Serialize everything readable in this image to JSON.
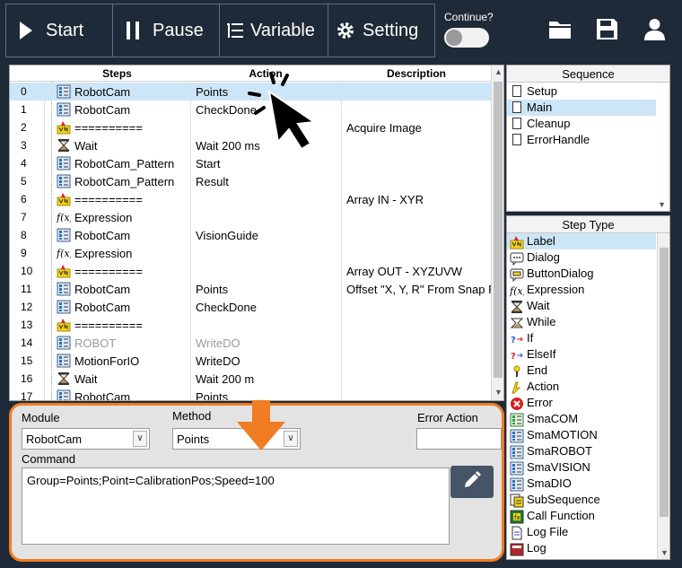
{
  "toolbar": {
    "start_label": "Start",
    "pause_label": "Pause",
    "variable_label": "Variable",
    "setting_label": "Setting",
    "continue_label": "Continue?"
  },
  "steps_table": {
    "columns": [
      "Steps",
      "Action",
      "Description"
    ],
    "rows": [
      {
        "num": "0",
        "step": "RobotCam",
        "action": "Points",
        "desc": "",
        "icon": "module-icon"
      },
      {
        "num": "1",
        "step": "RobotCam",
        "action": "CheckDone",
        "desc": "",
        "icon": "module-icon"
      },
      {
        "num": "2",
        "step": "==========",
        "action": "",
        "desc": "Acquire Image",
        "icon": "label-icon"
      },
      {
        "num": "3",
        "step": "Wait",
        "action": "Wait 200 ms",
        "desc": "",
        "icon": "hourglass-icon"
      },
      {
        "num": "4",
        "step": "RobotCam_Pattern",
        "action": "Start",
        "desc": "",
        "icon": "module-icon"
      },
      {
        "num": "5",
        "step": "RobotCam_Pattern",
        "action": "Result",
        "desc": "",
        "icon": "module-icon"
      },
      {
        "num": "6",
        "step": "==========",
        "action": "",
        "desc": "Array IN - XYR",
        "icon": "label-icon"
      },
      {
        "num": "7",
        "step": "Expression",
        "action": "",
        "desc": "",
        "icon": "expression-icon"
      },
      {
        "num": "8",
        "step": "RobotCam",
        "action": "VisionGuide",
        "desc": "",
        "icon": "module-icon"
      },
      {
        "num": "9",
        "step": "Expression",
        "action": "",
        "desc": "",
        "icon": "expression-icon"
      },
      {
        "num": "10",
        "step": "==========",
        "action": "",
        "desc": "Array OUT - XYZUVW",
        "icon": "label-icon"
      },
      {
        "num": "11",
        "step": "RobotCam",
        "action": "Points",
        "desc": "Offset \"X, Y, R\" From Snap P",
        "icon": "module-icon"
      },
      {
        "num": "12",
        "step": "RobotCam",
        "action": "CheckDone",
        "desc": "",
        "icon": "module-icon"
      },
      {
        "num": "13",
        "step": "==========",
        "action": "",
        "desc": "",
        "icon": "label-icon"
      },
      {
        "num": "14",
        "step": "ROBOT",
        "action": "WriteDO",
        "desc": "",
        "icon": "module-icon"
      },
      {
        "num": "15",
        "step": "MotionForIO",
        "action": "WriteDO",
        "desc": "",
        "icon": "module-icon"
      },
      {
        "num": "16",
        "step": "Wait",
        "action": "Wait 200 m",
        "desc": "",
        "icon": "hourglass-icon"
      },
      {
        "num": "17",
        "step": "RobotCam",
        "action": "Points",
        "desc": "",
        "icon": "module-icon"
      }
    ]
  },
  "sequence": {
    "title": "Sequence",
    "items": [
      "Setup",
      "Main",
      "Cleanup",
      "ErrorHandle"
    ]
  },
  "step_type": {
    "title": "Step Type",
    "items": [
      {
        "label": "Label",
        "icon": "label-icon"
      },
      {
        "label": "Dialog",
        "icon": "dialog-icon"
      },
      {
        "label": "ButtonDialog",
        "icon": "button-dialog-icon"
      },
      {
        "label": "Expression",
        "icon": "expression-icon"
      },
      {
        "label": "Wait",
        "icon": "hourglass-icon"
      },
      {
        "label": "While",
        "icon": "while-icon"
      },
      {
        "label": "If",
        "icon": "if-icon"
      },
      {
        "label": "ElseIf",
        "icon": "elseif-icon"
      },
      {
        "label": "End",
        "icon": "end-icon"
      },
      {
        "label": "Action",
        "icon": "action-icon"
      },
      {
        "label": "Error",
        "icon": "error-icon"
      },
      {
        "label": "SmaCOM",
        "icon": "module-green-icon"
      },
      {
        "label": "SmaMOTION",
        "icon": "module-blue-icon"
      },
      {
        "label": "SmaROBOT",
        "icon": "module-blue-icon"
      },
      {
        "label": "SmaVISION",
        "icon": "module-blue-icon"
      },
      {
        "label": "SmaDIO",
        "icon": "module-blue-icon"
      },
      {
        "label": "SubSequence",
        "icon": "subsequence-icon"
      },
      {
        "label": "Call Function",
        "icon": "call-function-icon"
      },
      {
        "label": "Log File",
        "icon": "log-file-icon"
      },
      {
        "label": "Log",
        "icon": "log-icon"
      }
    ]
  },
  "editor": {
    "module_label": "Module",
    "module_value": "RobotCam",
    "method_label": "Method",
    "method_value": "Points",
    "error_action_label": "Error Action",
    "error_action_value": "",
    "command_label": "Command",
    "command_value": "Group=Points;Point=CalibrationPos;Speed=100"
  },
  "colors": {
    "background": "#1f2a38",
    "selection": "#cde6f7",
    "highlight": "#f07c23"
  }
}
